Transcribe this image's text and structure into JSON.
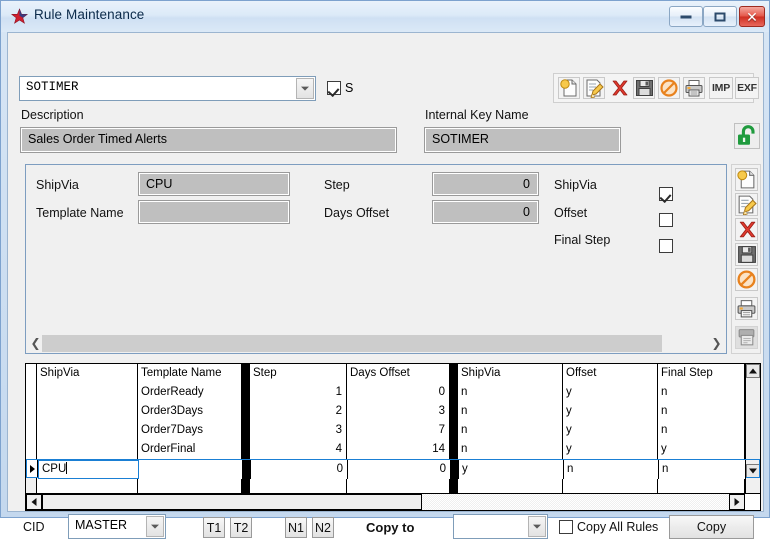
{
  "window": {
    "title": "Rule Maintenance",
    "icon": "star-icon",
    "buttons": {
      "minimize": "minimize",
      "maximize": "maximize",
      "close": "close"
    }
  },
  "header": {
    "rule_value": "SOTIMER",
    "s_checkbox": {
      "label": "S",
      "checked": true
    },
    "description_label": "Description",
    "description_value": "Sales Order Timed Alerts",
    "internal_key_label": "Internal Key Name",
    "internal_key_value": "SOTIMER",
    "lock_icon": "unlock-icon"
  },
  "toolbar_top": {
    "items": [
      {
        "name": "new-icon",
        "label": ""
      },
      {
        "name": "edit-icon",
        "label": ""
      },
      {
        "name": "delete-icon",
        "label": ""
      },
      {
        "name": "save-icon",
        "label": ""
      },
      {
        "name": "cancel-icon",
        "label": ""
      },
      {
        "name": "print-icon",
        "label": ""
      },
      {
        "name": "import-button",
        "label": "IMP"
      },
      {
        "name": "export-button",
        "label": "EXF"
      }
    ]
  },
  "toolbar_right": {
    "items": [
      {
        "name": "new-icon"
      },
      {
        "name": "edit-icon"
      },
      {
        "name": "delete-icon"
      },
      {
        "name": "save-icon"
      },
      {
        "name": "cancel-icon"
      },
      {
        "name": "print-icon"
      },
      {
        "name": "print-preview-icon"
      }
    ]
  },
  "detail": {
    "shipvia_label": "ShipVia",
    "shipvia_value": "CPU",
    "template_label": "Template Name",
    "template_value": "",
    "step_label": "Step",
    "step_value": "0",
    "days_offset_label": "Days Offset",
    "days_offset_value": "0",
    "flags": [
      {
        "label": "ShipVia",
        "checked": true
      },
      {
        "label": "Offset",
        "checked": false
      },
      {
        "label": "Final Step",
        "checked": false
      }
    ]
  },
  "grid": {
    "columns": [
      "ShipVia",
      "Template Name",
      "Step",
      "Days Offset",
      "ShipVia",
      "Offset",
      "Final Step"
    ],
    "rows": [
      {
        "shipvia": "",
        "template": "OrderReady",
        "step": "1",
        "days": "0",
        "f_shipvia": "n",
        "f_offset": "y",
        "f_final": "n",
        "current": false,
        "editing": false
      },
      {
        "shipvia": "",
        "template": "Order3Days",
        "step": "2",
        "days": "3",
        "f_shipvia": "n",
        "f_offset": "y",
        "f_final": "n",
        "current": false,
        "editing": false
      },
      {
        "shipvia": "",
        "template": "Order7Days",
        "step": "3",
        "days": "7",
        "f_shipvia": "n",
        "f_offset": "y",
        "f_final": "n",
        "current": false,
        "editing": false
      },
      {
        "shipvia": "",
        "template": "OrderFinal",
        "step": "4",
        "days": "14",
        "f_shipvia": "n",
        "f_offset": "y",
        "f_final": "y",
        "current": false,
        "editing": false
      },
      {
        "shipvia": "CPU",
        "template": "",
        "step": "0",
        "days": "0",
        "f_shipvia": "y",
        "f_offset": "n",
        "f_final": "n",
        "current": true,
        "editing": true
      }
    ]
  },
  "footer": {
    "cid_label": "CID",
    "cid_value": "MASTER",
    "t1_label": "T1",
    "t2_label": "T2",
    "n1_label": "N1",
    "n2_label": "N2",
    "copy_to_label": "Copy to",
    "copy_to_value": "",
    "copy_all_label": "Copy All Rules",
    "copy_all_checked": false,
    "copy_button": "Copy"
  },
  "colors": {
    "accent": "#1a7fd4",
    "title_text": "#0b2a4a",
    "field_gray": "#bfbfbf",
    "close_red": "#cf2f22",
    "lock_green": "#1f9b3e"
  }
}
